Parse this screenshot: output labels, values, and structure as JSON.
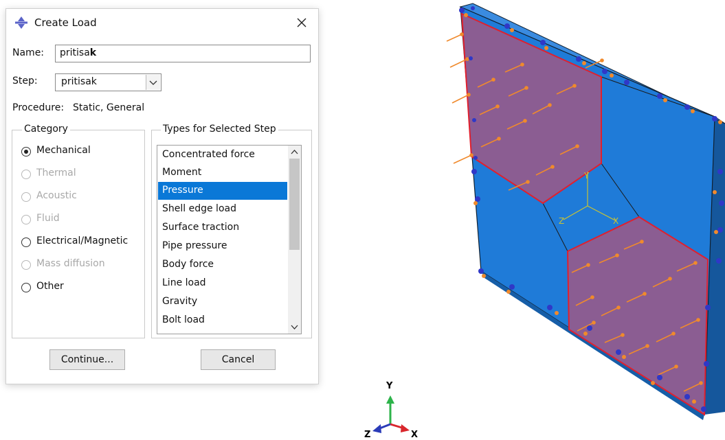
{
  "dialog": {
    "title": "Create Load",
    "name_label": "Name:",
    "name_value_prefix": "pritisa",
    "name_value_bold": "k",
    "step_label": "Step:",
    "step_value": "pritisak",
    "procedure_label": "Procedure:",
    "procedure_value": "Static, General",
    "category": {
      "title": "Category",
      "options": [
        {
          "label": "Mechanical",
          "selected": true,
          "enabled": true
        },
        {
          "label": "Thermal",
          "selected": false,
          "enabled": false
        },
        {
          "label": "Acoustic",
          "selected": false,
          "enabled": false
        },
        {
          "label": "Fluid",
          "selected": false,
          "enabled": false
        },
        {
          "label": "Electrical/Magnetic",
          "selected": false,
          "enabled": true
        },
        {
          "label": "Mass diffusion",
          "selected": false,
          "enabled": false
        },
        {
          "label": "Other",
          "selected": false,
          "enabled": true
        }
      ]
    },
    "types": {
      "title": "Types for Selected Step",
      "items": [
        "Concentrated force",
        "Moment",
        "Pressure",
        "Shell edge load",
        "Surface traction",
        "Pipe pressure",
        "Body force",
        "Line load",
        "Gravity",
        "Bolt load"
      ],
      "selected": "Pressure"
    },
    "continue_label": "Continue...",
    "cancel_label": "Cancel"
  },
  "model": {
    "csys_labels": {
      "x": "X",
      "y": "Y",
      "z": "Z"
    }
  },
  "triad": {
    "x": "X",
    "y": "Y",
    "z": "Z"
  },
  "colors": {
    "plate": "#1f7bd8",
    "load_surface": "#8b5d92",
    "surface_edge": "#e0202e",
    "pressure_arrow": "#f08a2c",
    "bc_symbol": "#2f38c7",
    "selection_blue": "#0a78d7"
  }
}
